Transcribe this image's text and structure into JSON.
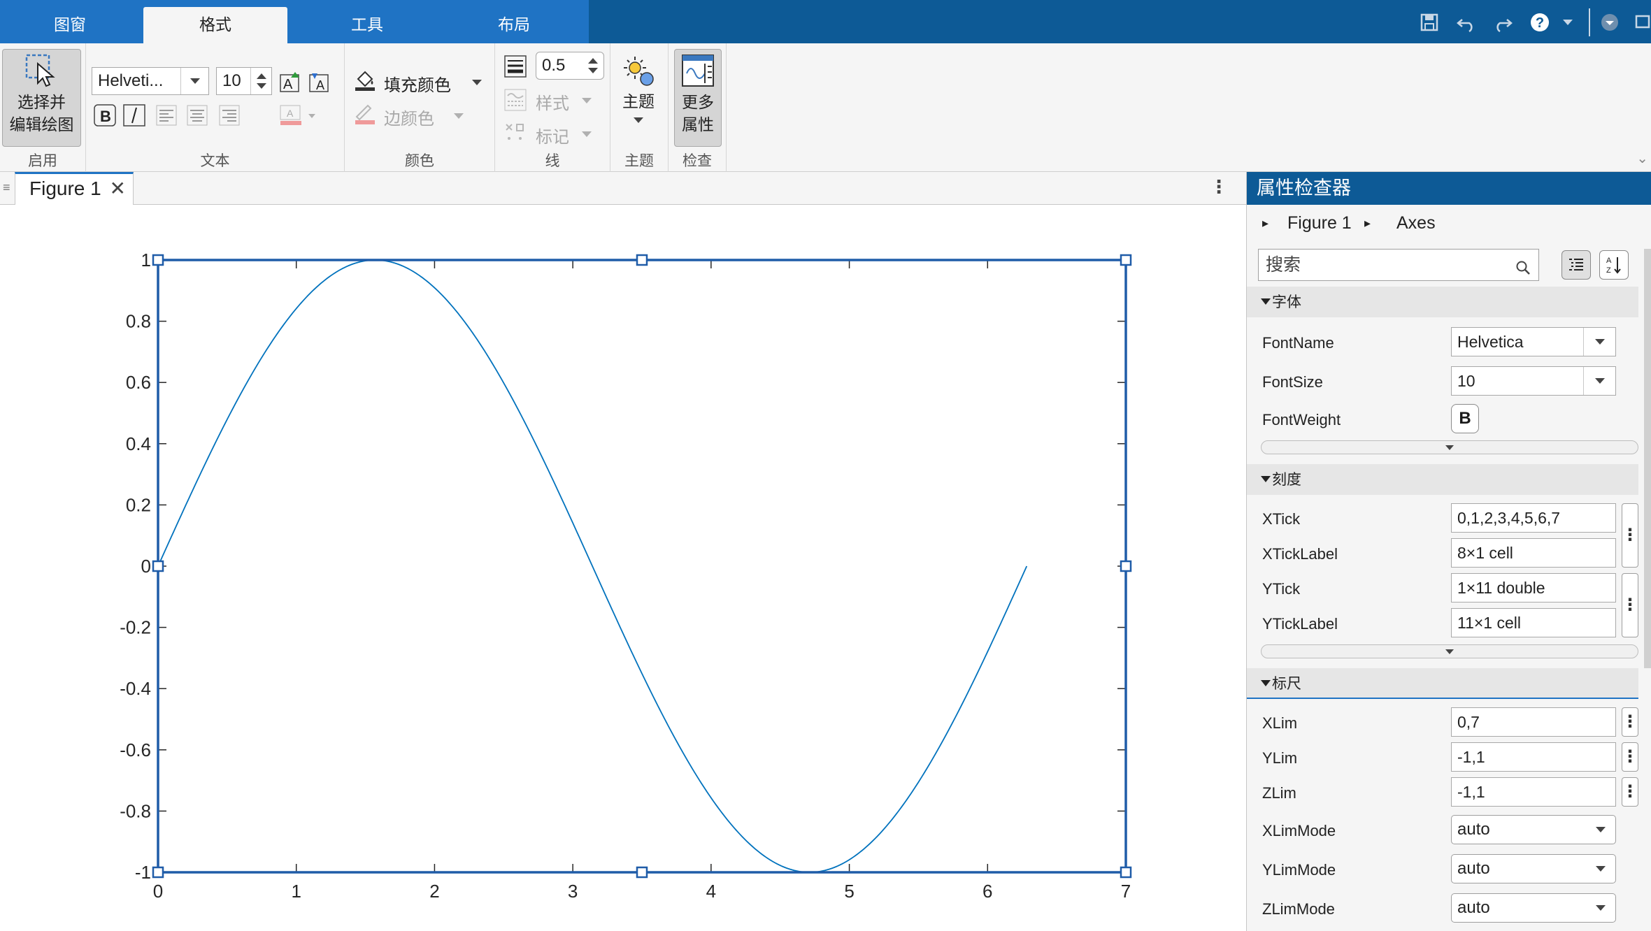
{
  "ribbon_tabs": [
    "图窗",
    "格式",
    "工具",
    "布局"
  ],
  "active_tab": "格式",
  "ribbon": {
    "enable": {
      "button_line1": "选择并",
      "button_line2": "编辑绘图",
      "label": "启用"
    },
    "text": {
      "font_name": "Helveti...",
      "font_size": "10",
      "label": "文本"
    },
    "color": {
      "fill": "填充颜色",
      "edge": "边颜色",
      "label": "颜色"
    },
    "line": {
      "width": "0.5",
      "style": "样式",
      "marker": "标记",
      "label": "线"
    },
    "theme": {
      "button": "主题",
      "label": "主题"
    },
    "inspect": {
      "button_line1": "更多",
      "button_line2": "属性",
      "label": "检查"
    }
  },
  "document_tab": {
    "title": "Figure 1"
  },
  "chart_data": {
    "type": "line",
    "function": "sin(x)",
    "x_range": [
      0,
      6.2832
    ],
    "xlim": [
      0,
      7
    ],
    "ylim": [
      -1,
      1
    ],
    "x_ticks": [
      "0",
      "1",
      "2",
      "3",
      "4",
      "5",
      "6",
      "7"
    ],
    "y_ticks": [
      "-1",
      "-0.8",
      "-0.6",
      "-0.4",
      "-0.2",
      "0",
      "0.2",
      "0.4",
      "0.6",
      "0.8",
      "1"
    ],
    "line_color": "#0072bd",
    "axes_color": "#1f5ca8",
    "selected": true
  },
  "inspector": {
    "title": "属性检查器",
    "breadcrumb": [
      "Figure 1",
      "Axes"
    ],
    "search_placeholder": "搜索",
    "sections": {
      "font": {
        "title": "字体",
        "font_name_label": "FontName",
        "font_name": "Helvetica",
        "font_size_label": "FontSize",
        "font_size": "10",
        "font_weight_label": "FontWeight",
        "font_weight": "B"
      },
      "ticks": {
        "title": "刻度",
        "xtick_label": "XTick",
        "xtick": "0,1,2,3,4,5,6,7",
        "xticklabel_label": "XTickLabel",
        "xticklabel": "8×1 cell",
        "ytick_label": "YTick",
        "ytick": "1×11 double",
        "yticklabel_label": "YTickLabel",
        "yticklabel": "11×1 cell"
      },
      "rulers": {
        "title": "标尺",
        "xlim_label": "XLim",
        "xlim": "0,7",
        "ylim_label": "YLim",
        "ylim": "-1,1",
        "zlim_label": "ZLim",
        "zlim": "-1,1",
        "xlimmode_label": "XLimMode",
        "xlimmode": "auto",
        "ylimmode_label": "YLimMode",
        "ylimmode": "auto",
        "zlimmode_label": "ZLimMode",
        "zlimmode": "auto"
      }
    }
  }
}
